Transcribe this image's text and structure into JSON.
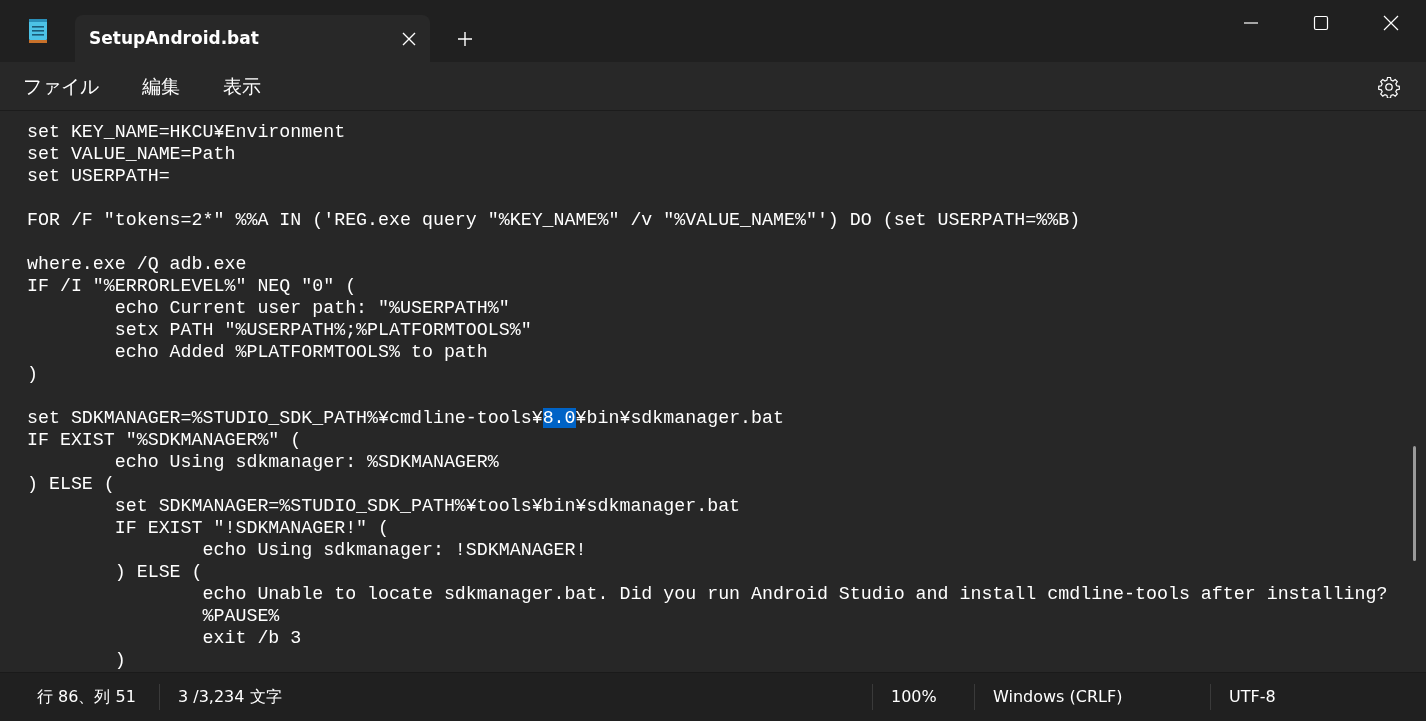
{
  "window": {
    "title": "SetupAndroid.bat"
  },
  "menu": [
    {
      "label": "ファイル"
    },
    {
      "label": "編集"
    },
    {
      "label": "表示"
    }
  ],
  "editor": {
    "lines": [
      {
        "kind": "text",
        "text": "set KEY_NAME=HKCU¥Environment"
      },
      {
        "kind": "text",
        "text": "set VALUE_NAME=Path"
      },
      {
        "kind": "text",
        "text": "set USERPATH="
      },
      {
        "kind": "blank"
      },
      {
        "kind": "text",
        "text": "FOR /F \"tokens=2*\" %%A IN ('REG.exe query \"%KEY_NAME%\" /v \"%VALUE_NAME%\"') DO (set USERPATH=%%B)"
      },
      {
        "kind": "blank"
      },
      {
        "kind": "text",
        "text": "where.exe /Q adb.exe"
      },
      {
        "kind": "text",
        "text": "IF /I \"%ERRORLEVEL%\" NEQ \"0\" ("
      },
      {
        "kind": "text",
        "text": "\techo Current user path: \"%USERPATH%\""
      },
      {
        "kind": "text",
        "text": "\tsetx PATH \"%USERPATH%;%PLATFORMTOOLS%\""
      },
      {
        "kind": "text",
        "text": "\techo Added %PLATFORMTOOLS% to path"
      },
      {
        "kind": "text",
        "text": ")"
      },
      {
        "kind": "blank"
      },
      {
        "kind": "segments",
        "segments": [
          {
            "text": "set SDKMANAGER=%STUDIO_SDK_PATH%¥cmdline-tools¥",
            "selected": false
          },
          {
            "text": "8.0",
            "selected": true
          },
          {
            "text": "¥bin¥sdkmanager.bat",
            "selected": false
          }
        ]
      },
      {
        "kind": "text",
        "text": "IF EXIST \"%SDKMANAGER%\" ("
      },
      {
        "kind": "text",
        "text": "\techo Using sdkmanager: %SDKMANAGER%"
      },
      {
        "kind": "text",
        "text": ") ELSE ("
      },
      {
        "kind": "text",
        "text": "\tset SDKMANAGER=%STUDIO_SDK_PATH%¥tools¥bin¥sdkmanager.bat"
      },
      {
        "kind": "text",
        "text": "\tIF EXIST \"!SDKMANAGER!\" ("
      },
      {
        "kind": "text",
        "text": "\t\techo Using sdkmanager: !SDKMANAGER!"
      },
      {
        "kind": "text",
        "text": "\t) ELSE ("
      },
      {
        "kind": "text",
        "text": "\t\techo Unable to locate sdkmanager.bat. Did you run Android Studio and install cmdline-tools after installing?"
      },
      {
        "kind": "text",
        "text": "\t\t%PAUSE%"
      },
      {
        "kind": "text",
        "text": "\t\texit /b 3"
      },
      {
        "kind": "text",
        "text": "\t)"
      }
    ]
  },
  "status_bar": [
    {
      "text": "行 86、列 51"
    },
    {
      "text": "3 /3,234 文字"
    },
    {
      "text": "100%"
    },
    {
      "text": "Windows (CRLF)"
    },
    {
      "text": "UTF-8"
    }
  ]
}
